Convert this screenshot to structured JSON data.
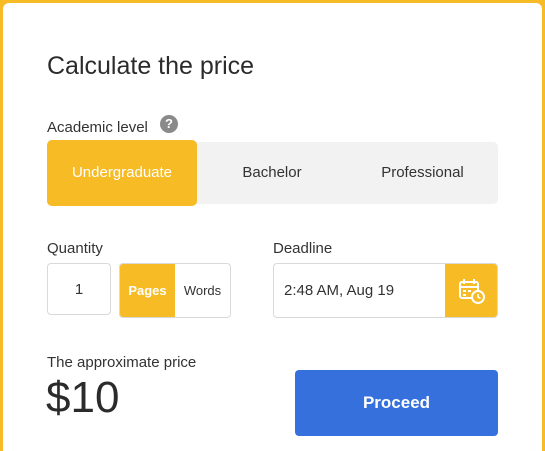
{
  "calculator": {
    "title": "Calculate the price",
    "academic_level": {
      "label": "Academic level",
      "help_icon": "question-icon",
      "help_glyph": "?",
      "options": [
        "Undergraduate",
        "Bachelor",
        "Professional"
      ],
      "selected": "Undergraduate"
    },
    "quantity": {
      "label": "Quantity",
      "value": "1",
      "units": [
        "Pages",
        "Words"
      ],
      "selected_unit": "Pages"
    },
    "deadline": {
      "label": "Deadline",
      "value": "2:48 AM, Aug 19",
      "icon": "calendar-clock-icon"
    },
    "price": {
      "label": "The approximate price",
      "value": "$10"
    },
    "proceed_label": "Proceed"
  },
  "colors": {
    "accent": "#f6bb25",
    "primary_button": "#3570dc",
    "segment_bg": "#f2f2f2",
    "text": "#2b2b2b"
  }
}
